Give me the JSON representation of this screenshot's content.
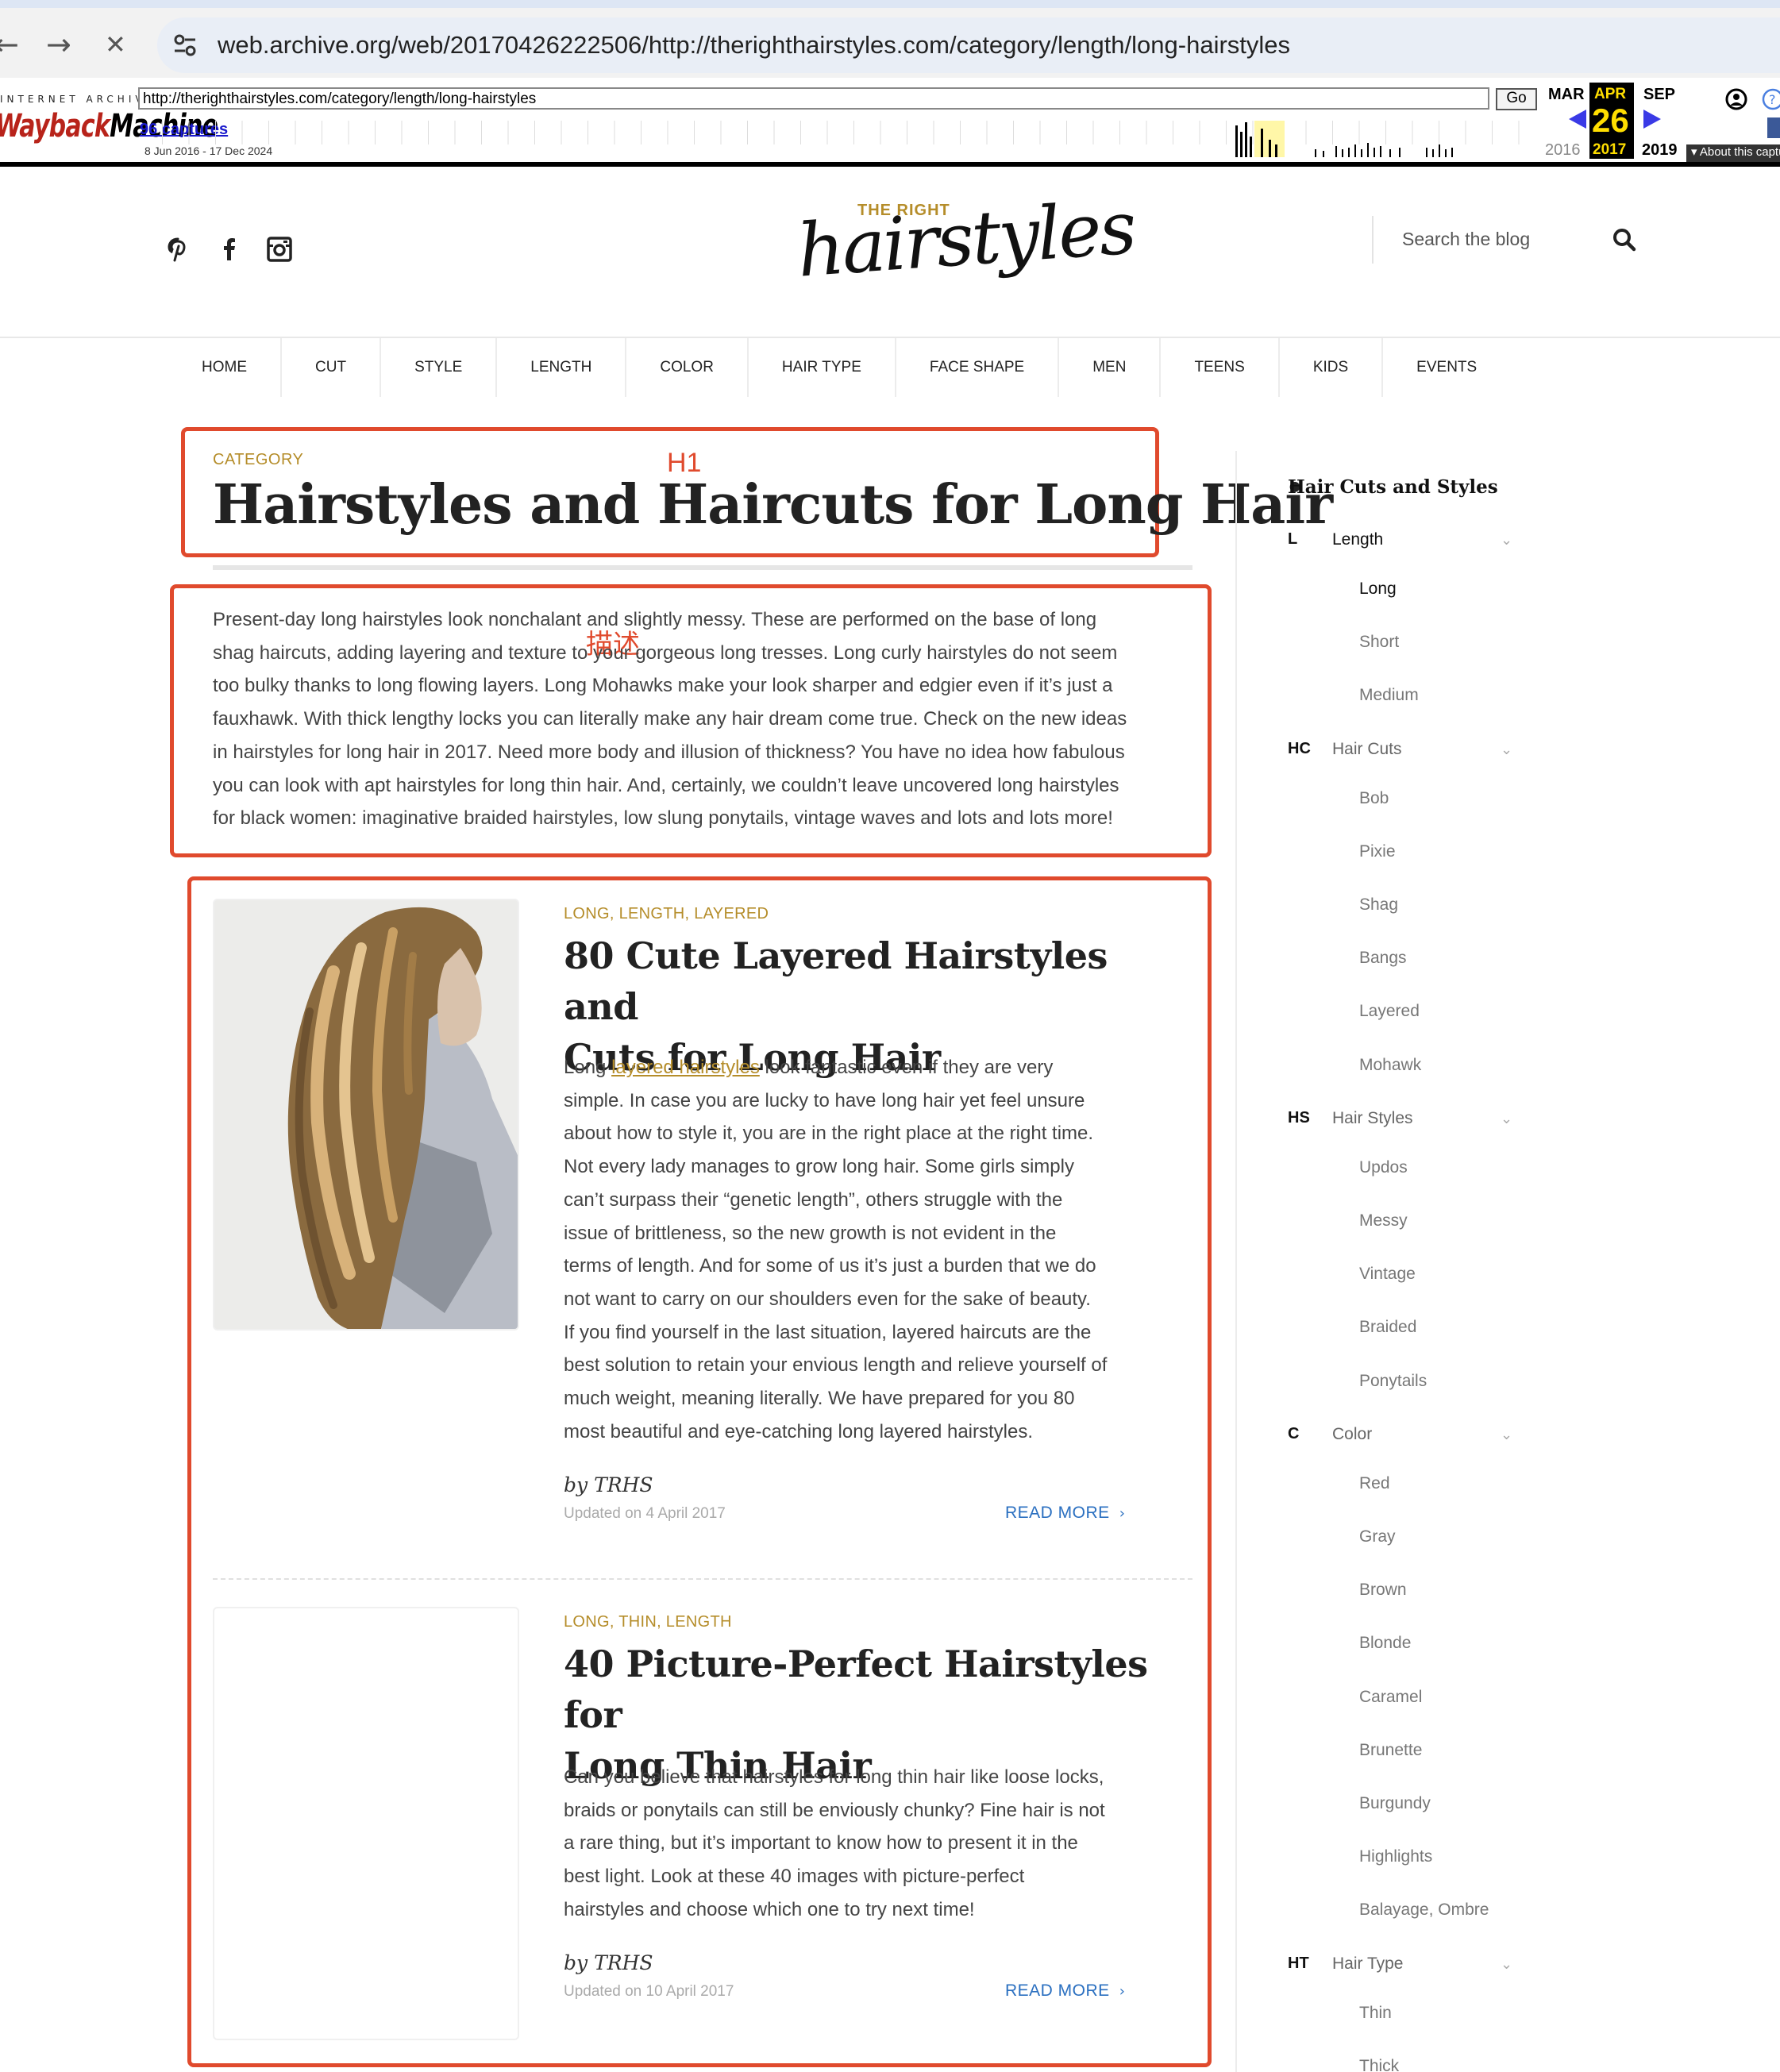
{
  "browser": {
    "back": "←",
    "forward": "→",
    "stop": "✕",
    "url": "web.archive.org/web/20170426222506/http://therighthairstyles.com/category/length/long-hairstyles"
  },
  "wayback": {
    "ia_label": "INTERNET ARCHIVE",
    "logo_part1": "Wayback",
    "logo_part2": "Machine",
    "url_value": "http://therighthairstyles.com/category/length/long-hairstyles",
    "go_label": "Go",
    "captures": "96 captures",
    "range": "8 Jun 2016 - 17 Dec 2024",
    "prev_month": "MAR",
    "cur_month": "APR",
    "next_month": "SEP",
    "day": "26",
    "prev_year": "2016",
    "cur_year": "2017",
    "next_year": "2019",
    "about": "▾ About this capture"
  },
  "site": {
    "logo_small": "THE RIGHT",
    "logo_big": "hairstyles",
    "search_placeholder": "Search the blog",
    "nav": [
      "HOME",
      "CUT",
      "STYLE",
      "LENGTH",
      "COLOR",
      "HAIR TYPE",
      "FACE SHAPE",
      "MEN",
      "TEENS",
      "KIDS",
      "EVENTS"
    ]
  },
  "content": {
    "category_label": "CATEGORY",
    "title": "Hairstyles and Haircuts for Long Hair",
    "intro_lines": [
      "Present-day long hairstyles look nonchalant and slightly messy. These are performed on the base of long",
      "shag haircuts, adding layering and texture to your gorgeous long tresses. Long curly hairstyles do not seem",
      "too bulky thanks to long flowing layers. Long Mohawks make your look sharper and edgier even if it’s just a",
      "fauxhawk. With thick lengthy locks you can literally make any hair dream come true. Check on the new ideas",
      "in hairstyles for long hair in 2017. Need more body and illusion of thickness? You have no idea how fabulous",
      "you can look with apt hairstyles for long thin hair. And, certainly, we couldn’t leave uncovered long hairstyles",
      "for black women: imaginative braided hairstyles, low slung ponytails, vintage waves and lots and lots more!"
    ],
    "annotations": {
      "h1": "H1",
      "desc": "描述"
    },
    "posts": [
      {
        "cats": "LONG, LENGTH, LAYERED",
        "title_lines": [
          "80 Cute Layered Hairstyles and",
          "Cuts for Long Hair"
        ],
        "excerpt_first_pre": "Long ",
        "excerpt_link": "layered hairstyles",
        "excerpt_first_post": " look fantastic even if they are very",
        "excerpt_lines": [
          "simple. In case you are lucky to have long hair yet feel unsure",
          "about how to style it, you are in the right place at the right time.",
          "Not every lady manages to grow long hair. Some girls simply",
          "can’t surpass their “genetic length”, others struggle with the",
          "issue of brittleness, so the new growth is not evident in the",
          "terms of length. And for some of us it’s just a burden that we do",
          "not want to carry on our shoulders even for the sake of beauty.",
          "If you find yourself in the last situation, layered haircuts are the",
          "best solution to retain your envious length and relieve yourself of",
          "much weight, meaning literally. We have prepared for you 80",
          "most beautiful and eye-catching long layered hairstyles."
        ],
        "author": "by TRHS",
        "updated": "Updated on 4 April 2017",
        "read_more": "READ MORE"
      },
      {
        "cats": "LONG, THIN, LENGTH",
        "title_lines": [
          "40 Picture-Perfect Hairstyles for",
          "Long Thin Hair"
        ],
        "excerpt_lines": [
          "Can you believe that hairstyles for long thin hair like loose locks,",
          "braids or ponytails can still be enviously chunky? Fine hair is not",
          "a rare thing, but it’s important to know how to present it in the",
          "best light. Look at these 40 images with picture-perfect",
          "hairstyles and choose which one to try next time!"
        ],
        "author": "by TRHS",
        "updated": "Updated on 10 April 2017",
        "read_more": "READ MORE"
      }
    ]
  },
  "sidebar": {
    "title": "Hair Cuts and Styles",
    "groups": [
      {
        "abbr": "L",
        "label": "Length",
        "items": [
          "Long",
          "Short",
          "Medium"
        ]
      },
      {
        "abbr": "HC",
        "label": "Hair Cuts",
        "items": [
          "Bob",
          "Pixie",
          "Shag",
          "Bangs",
          "Layered",
          "Mohawk"
        ]
      },
      {
        "abbr": "HS",
        "label": "Hair Styles",
        "items": [
          "Updos",
          "Messy",
          "Vintage",
          "Braided",
          "Ponytails"
        ]
      },
      {
        "abbr": "C",
        "label": "Color",
        "items": [
          "Red",
          "Gray",
          "Brown",
          "Blonde",
          "Caramel",
          "Brunette",
          "Burgundy",
          "Highlights",
          "Balayage, Ombre"
        ]
      },
      {
        "abbr": "HT",
        "label": "Hair Type",
        "items": [
          "Thin",
          "Thick"
        ]
      }
    ]
  },
  "colors": {
    "accent_gold": "#b58d2a",
    "annotation_red": "#e04a2d",
    "link_blue": "#2a6fc0"
  }
}
